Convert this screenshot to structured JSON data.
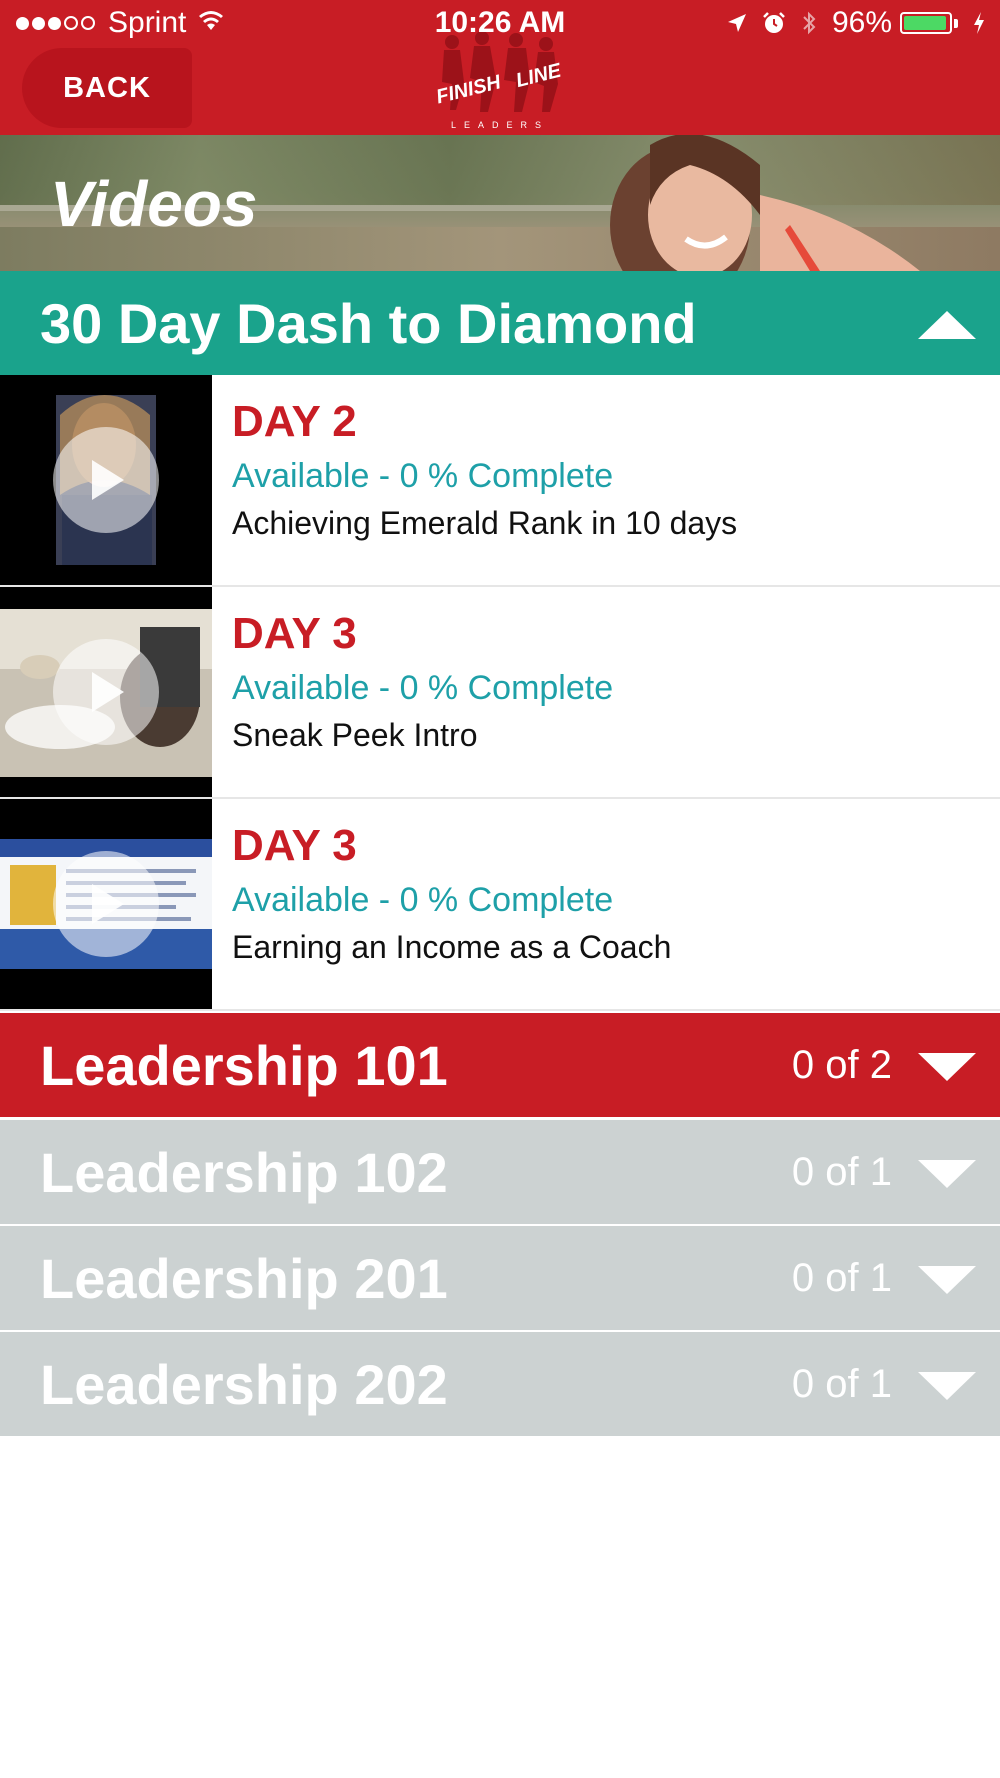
{
  "status_bar": {
    "carrier": "Sprint",
    "time": "10:26 AM",
    "battery": "96%",
    "battery_level": 0.96,
    "signal_bars_filled": 3,
    "signal_bars_total": 5,
    "icons": [
      "wifi-icon",
      "location-arrow-icon",
      "alarm-icon",
      "bluetooth-icon",
      "battery-icon",
      "charging-bolt-icon"
    ]
  },
  "nav": {
    "back_label": "BACK",
    "logo_text_1": "FINISH",
    "logo_text_2": "LINE",
    "logo_text_3": "LEADERS"
  },
  "hero": {
    "title": "Videos"
  },
  "colors": {
    "brand_red": "#c81d25",
    "teal": "#1aa38c",
    "gray": "#ccd2d2",
    "status_teal": "#1ea0a8"
  },
  "sections": [
    {
      "title": "30 Day Dash to Diamond",
      "expanded": true,
      "videos": [
        {
          "day": "DAY 2",
          "status": "Available - 0 % Complete",
          "title": "Achieving Emerald Rank in 10 days"
        },
        {
          "day": "DAY 3",
          "status": "Available - 0 % Complete",
          "title": "Sneak Peek Intro"
        },
        {
          "day": "DAY 3",
          "status": "Available - 0 % Complete",
          "title": "Earning an Income as a Coach"
        }
      ]
    },
    {
      "title": "Leadership 101",
      "count": "0 of 2",
      "expanded": false
    },
    {
      "title": "Leadership 102",
      "count": "0 of 1",
      "expanded": false
    },
    {
      "title": "Leadership 201",
      "count": "0 of 1",
      "expanded": false
    },
    {
      "title": "Leadership 202",
      "count": "0 of 1",
      "expanded": false
    }
  ]
}
